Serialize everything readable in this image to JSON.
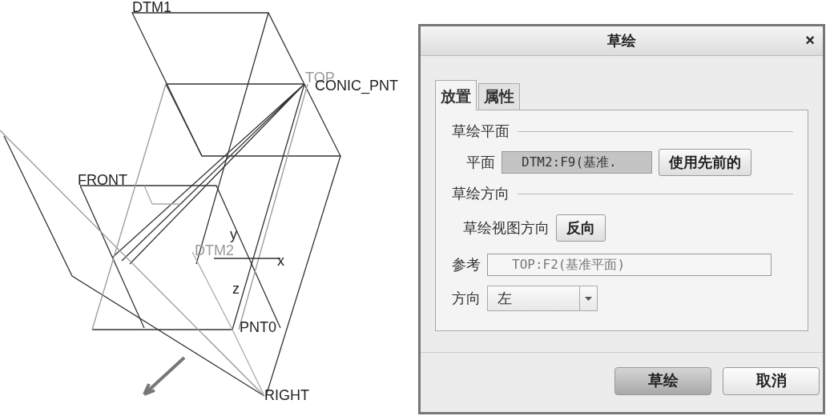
{
  "canvas": {
    "labels": [
      {
        "text": "DTM1",
        "dimmed": false
      },
      {
        "text": "TOP",
        "dimmed": true
      },
      {
        "text": "CONIC_PNT",
        "dimmed": false
      },
      {
        "text": "FRONT",
        "dimmed": false
      },
      {
        "text": "y",
        "dimmed": false
      },
      {
        "text": "DTM2",
        "dimmed": true
      },
      {
        "text": "x",
        "dimmed": false
      },
      {
        "text": "z",
        "dimmed": false
      },
      {
        "text": "PNT0",
        "dimmed": false
      },
      {
        "text": "RIGHT",
        "dimmed": false
      }
    ]
  },
  "dialog": {
    "title": "草绘",
    "close": "×",
    "tabs": [
      {
        "label": "放置",
        "selected": true
      },
      {
        "label": "属性",
        "selected": false
      }
    ],
    "plane_section": {
      "heading": "草绘平面",
      "label": "平面",
      "value": "DTM2:F9(基准.",
      "button": "使用先前的"
    },
    "direction_section": {
      "heading": "草绘方向",
      "view_label": "草绘视图方向",
      "view_button": "反向",
      "reference_label": "参考",
      "reference_value": "TOP:F2(基准平面)",
      "orientation_label": "方向",
      "orientation_value": "左"
    },
    "buttons": [
      {
        "label": "草绘",
        "default": true
      },
      {
        "label": "取消",
        "default": false
      }
    ]
  }
}
